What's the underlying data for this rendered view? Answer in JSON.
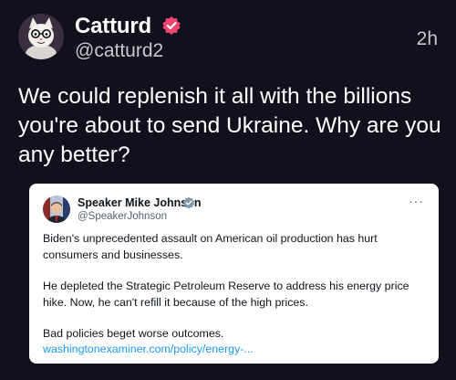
{
  "post": {
    "author_name": "Catturd",
    "author_handle": "@catturd2",
    "timestamp": "2h",
    "text": "We could replenish it all with the billions you're about to send Ukraine. Why are you any better?",
    "verified_color": "#f0466e"
  },
  "quote": {
    "author_name": "Speaker Mike Johnson",
    "author_handle": "@SpeakerJohnson",
    "more_label": "···",
    "paragraphs": [
      "Biden's unprecedented assault on American oil production has hurt consumers and businesses.",
      "He depleted the Strategic Petroleum Reserve to address his energy price hike. Now, he can't refill it because of the high prices.",
      "Bad policies beget worse outcomes."
    ],
    "link_text": "washingtonexaminer.com/policy/energy-...",
    "verified_color": "#829aab",
    "link_color": "#1d9bf0"
  },
  "icons": {
    "avatar": "cat-avatar-icon",
    "quote_avatar": "speaker-avatar-icon",
    "verified": "verified-badge-icon",
    "more": "more-options-icon"
  }
}
